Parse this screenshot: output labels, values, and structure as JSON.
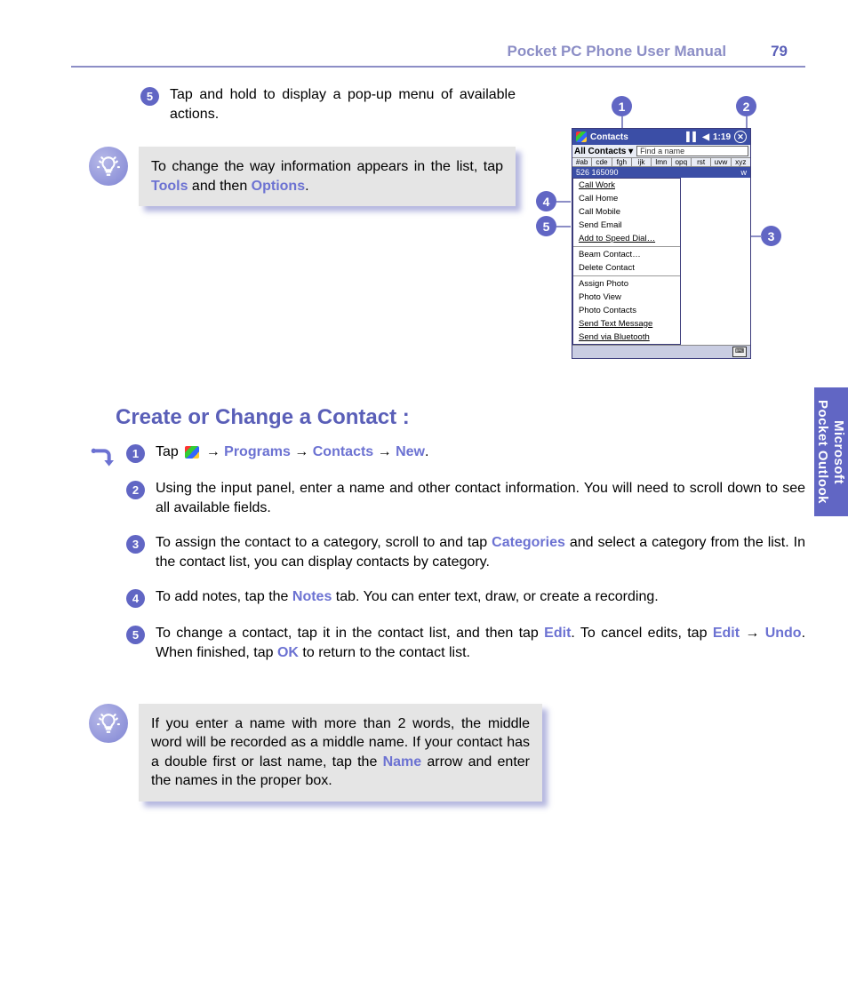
{
  "header": {
    "title": "Pocket PC Phone User Manual",
    "page": "79"
  },
  "top_step": {
    "num": "5",
    "text": "Tap and hold to display a pop-up menu of available actions."
  },
  "tip1": {
    "pre": "To change the way information appears in the list, tap ",
    "tools": "Tools",
    "mid": " and then ",
    "options": "Options",
    "post": "."
  },
  "heading": "Create or Change a Contact :",
  "steps": [
    {
      "num": "1",
      "parts": [
        "Tap ",
        "",
        " → ",
        "Programs",
        " → ",
        "Contacts",
        " → ",
        "New",
        "."
      ]
    },
    {
      "num": "2",
      "text": "Using the input panel, enter a name and other contact information. You will need to scroll down to see all available fields."
    },
    {
      "num": "3",
      "pre": "To assign the contact to a category, scroll to and tap ",
      "kw": "Categories",
      "post": " and select a category from the list. In the contact list, you can display contacts by category."
    },
    {
      "num": "4",
      "pre": "To add notes, tap the ",
      "kw": "Notes",
      "post": " tab. You can enter text, draw, or create a recording."
    },
    {
      "num": "5",
      "a": "To change a contact, tap it in the contact list, and then tap ",
      "b": "Edit",
      "c": ". To cancel edits, tap ",
      "d": "Edit",
      "e": " → ",
      "f": "Undo",
      "g": ". When finished, tap ",
      "h": "OK",
      "i": " to return to the contact list."
    }
  ],
  "tip2": {
    "a": "If you enter a name with more than 2 words, the middle word will be recorded as a middle name. If your contact has a double first or last name, tap the ",
    "b": "Name",
    "c": " arrow and enter the names in the proper box."
  },
  "sidetab": {
    "line1": "Microsoft",
    "line2": "Pocket Outlook"
  },
  "callouts": {
    "c1": "1",
    "c2": "2",
    "c3": "3",
    "c4": "4",
    "c5": "5"
  },
  "ppc": {
    "title": "Contacts",
    "time": "1:19",
    "drop": "All Contacts ▾",
    "find": "Find a name",
    "alpha": [
      "#ab",
      "cde",
      "fgh",
      "ijk",
      "lmn",
      "opq",
      "rst",
      "uvw",
      "xyz"
    ],
    "entry_num": "526 165090",
    "entry_w": "w",
    "menu": [
      "Call Work",
      "Call Home",
      "Call Mobile",
      "Send Email",
      "Add to Speed Dial…",
      "—",
      "Beam Contact…",
      "Delete Contact",
      "—",
      "Assign Photo",
      "Photo View",
      "Photo Contacts",
      "Send Text Message",
      "Send via Bluetooth"
    ]
  }
}
